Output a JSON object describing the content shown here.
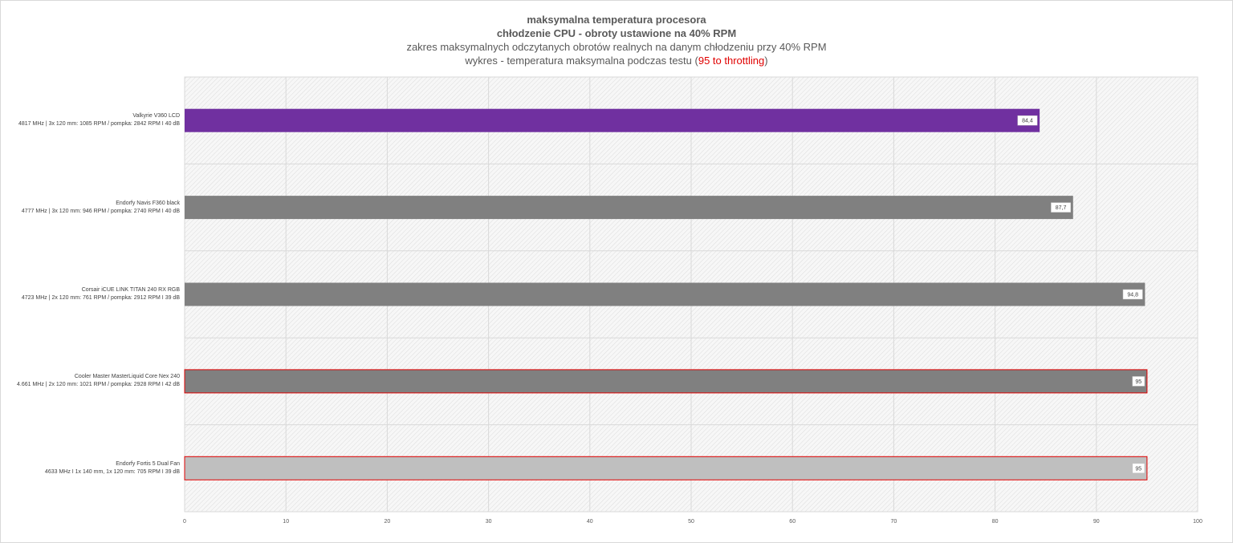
{
  "title": {
    "line1": "maksymalna temperatura procesora",
    "line2": "chłodzenie CPU - obroty ustawione na 40% RPM",
    "line3": "zakres maksymalnych odczytanych obrotów realnych na danym chłodzeniu przy 40% RPM",
    "line4_prefix": "wykres - temperatura maksymalna podczas testu (",
    "line4_highlight": "95 to throttling",
    "line4_suffix": ")"
  },
  "chart_data": {
    "type": "bar",
    "orientation": "horizontal",
    "xlim": [
      0,
      100
    ],
    "xticks": [
      0,
      10,
      20,
      30,
      40,
      50,
      60,
      70,
      80,
      90,
      100
    ],
    "grid": true,
    "categories": [
      {
        "name": "Valkyrie V360 LCD",
        "details": "4817 MHz | 3x 120 mm: 1085 RPM / pompka: 2842 RPM I 40 dB"
      },
      {
        "name": "Endorfy Navis F360 black",
        "details": "4777 MHz | 3x 120 mm: 946 RPM / pompka: 2740 RPM I 40 dB"
      },
      {
        "name": "Corsair iCUE LINK TITAN 240 RX RGB",
        "details": "4723 MHz | 2x 120 mm: 761 RPM / pompka: 2912 RPM I 39 dB"
      },
      {
        "name": "Cooler Master MasterLiquid Core Nex 240",
        "details": "4.661 MHz | 2x 120 mm: 1021 RPM / pompka: 2928 RPM I 42 dB"
      },
      {
        "name": "Endorfy Fortis 5 Dual Fan",
        "details": "4633 MHz I 1x 140 mm, 1x 120 mm: 705 RPM I 39 dB"
      }
    ],
    "values": [
      84.4,
      87.7,
      94.8,
      95,
      95
    ],
    "value_labels": [
      "84,4",
      "87,7",
      "94,8",
      "95",
      "95"
    ],
    "colors": [
      "#7030a0",
      "#808080",
      "#808080",
      "#808080",
      "#bfbfbf"
    ],
    "outline": [
      "none",
      "none",
      "none",
      "#e00000",
      "#e00000"
    ]
  }
}
